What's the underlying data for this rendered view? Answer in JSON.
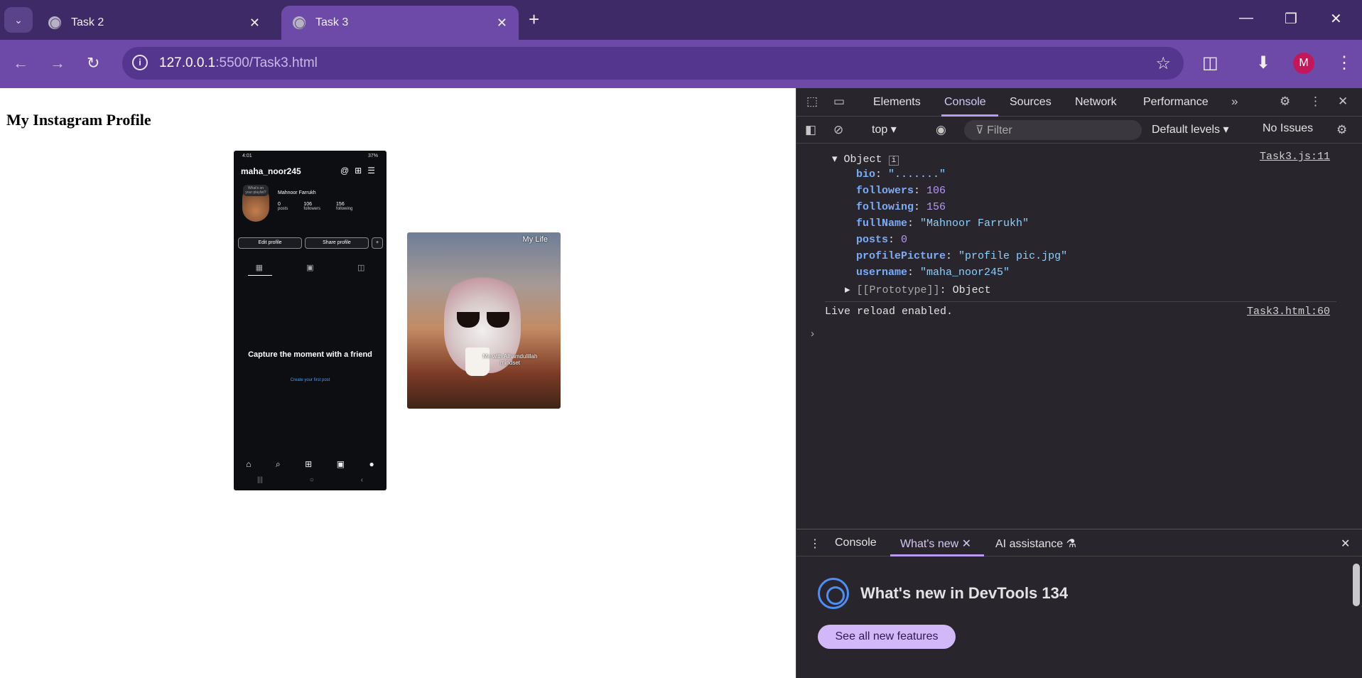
{
  "browser": {
    "tabs": [
      {
        "title": "Task 2",
        "active": false
      },
      {
        "title": "Task 3",
        "active": true
      }
    ],
    "url_host": "127.0.0.1",
    "url_rest": ":5500/Task3.html",
    "profile_initial": "M",
    "accent": "#6e4aa8"
  },
  "page": {
    "heading": "My Instagram Profile",
    "phone": {
      "status_time": "4:01",
      "status_right": "37%",
      "username": "maha_noor245",
      "note": "What's on your playlist?",
      "full_name": "Mahnoor Farrukh",
      "stats": [
        {
          "value": "0",
          "label": "posts"
        },
        {
          "value": "106",
          "label": "followers"
        },
        {
          "value": "156",
          "label": "following"
        }
      ],
      "edit_btn": "Edit profile",
      "share_btn": "Share profile",
      "caption": "Capture the moment with a friend",
      "link": "Create your first post"
    },
    "cat_image": {
      "caption_top": "My Life",
      "caption_mid": "Me with Alhamdulillah mindset"
    }
  },
  "devtools": {
    "tabs": [
      "Elements",
      "Console",
      "Sources",
      "Network",
      "Performance"
    ],
    "active_tab": "Console",
    "context": "top",
    "filter_placeholder": "Filter",
    "levels": "Default levels",
    "issues": "No Issues",
    "console": {
      "object_label": "Object",
      "object_source": "Task3.js:11",
      "props": [
        {
          "key": "bio",
          "value": "\".......\"",
          "type": "s"
        },
        {
          "key": "followers",
          "value": "106",
          "type": "n"
        },
        {
          "key": "following",
          "value": "156",
          "type": "n"
        },
        {
          "key": "fullName",
          "value": "\"Mahnoor Farrukh\"",
          "type": "s"
        },
        {
          "key": "posts",
          "value": "0",
          "type": "n"
        },
        {
          "key": "profilePicture",
          "value": "\"profile pic.jpg\"",
          "type": "s"
        },
        {
          "key": "username",
          "value": "\"maha_noor245\"",
          "type": "s"
        }
      ],
      "prototype": "[[Prototype]]",
      "prototype_value": "Object",
      "reload_msg": "Live reload enabled.",
      "reload_source": "Task3.html:60"
    },
    "drawer": {
      "tabs": [
        "Console",
        "What's new",
        "AI assistance"
      ],
      "active": "What's new",
      "title": "What's new in DevTools 134",
      "button": "See all new features"
    }
  }
}
